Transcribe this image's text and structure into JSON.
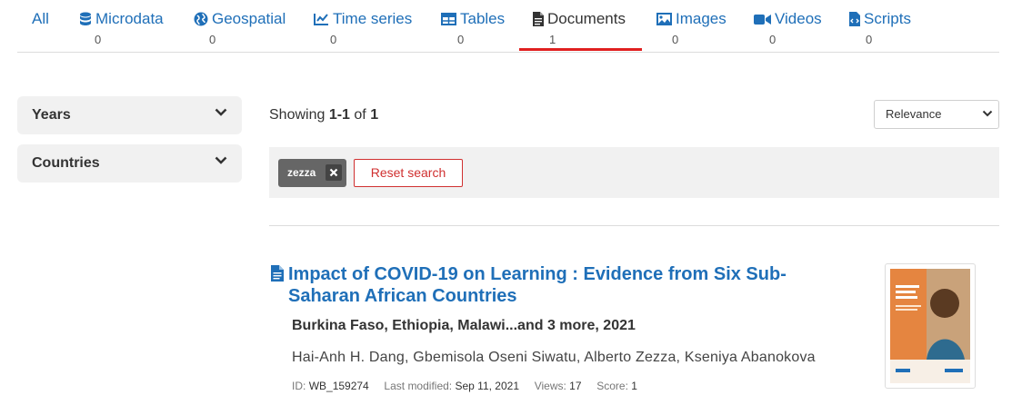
{
  "tabs": [
    {
      "label": "All",
      "count": ""
    },
    {
      "label": "Microdata",
      "count": "0"
    },
    {
      "label": "Geospatial",
      "count": "0"
    },
    {
      "label": "Time series",
      "count": "0"
    },
    {
      "label": "Tables",
      "count": "0"
    },
    {
      "label": "Documents",
      "count": "1"
    },
    {
      "label": "Images",
      "count": "0"
    },
    {
      "label": "Videos",
      "count": "0"
    },
    {
      "label": "Scripts",
      "count": "0"
    }
  ],
  "sidebar": {
    "facets": [
      {
        "label": "Years"
      },
      {
        "label": "Countries"
      }
    ]
  },
  "results_summary": {
    "prefix": "Showing",
    "range": "1-1",
    "of_label": "of",
    "total": "1"
  },
  "sort": {
    "selected": "Relevance"
  },
  "filters": {
    "chip_label": "zezza",
    "reset_label": "Reset search"
  },
  "result": {
    "title": "Impact of COVID-19 on Learning : Evidence from Six Sub-Saharan African Countries",
    "meta": "Burkina Faso, Ethiopia, Malawi...and 3 more, 2021",
    "authors": "Hai-Anh H. Dang, Gbemisola Oseni Siwatu, Alberto Zezza, Kseniya Abanokova",
    "id_label": "ID:",
    "id_value": "WB_159274",
    "modified_label": "Last modified:",
    "modified_value": "Sep 11, 2021",
    "views_label": "Views:",
    "views_value": "17",
    "score_label": "Score:",
    "score_value": "1"
  },
  "colors": {
    "link": "#1f6fb8",
    "active_underline": "#e02020",
    "reset": "#d03030"
  }
}
